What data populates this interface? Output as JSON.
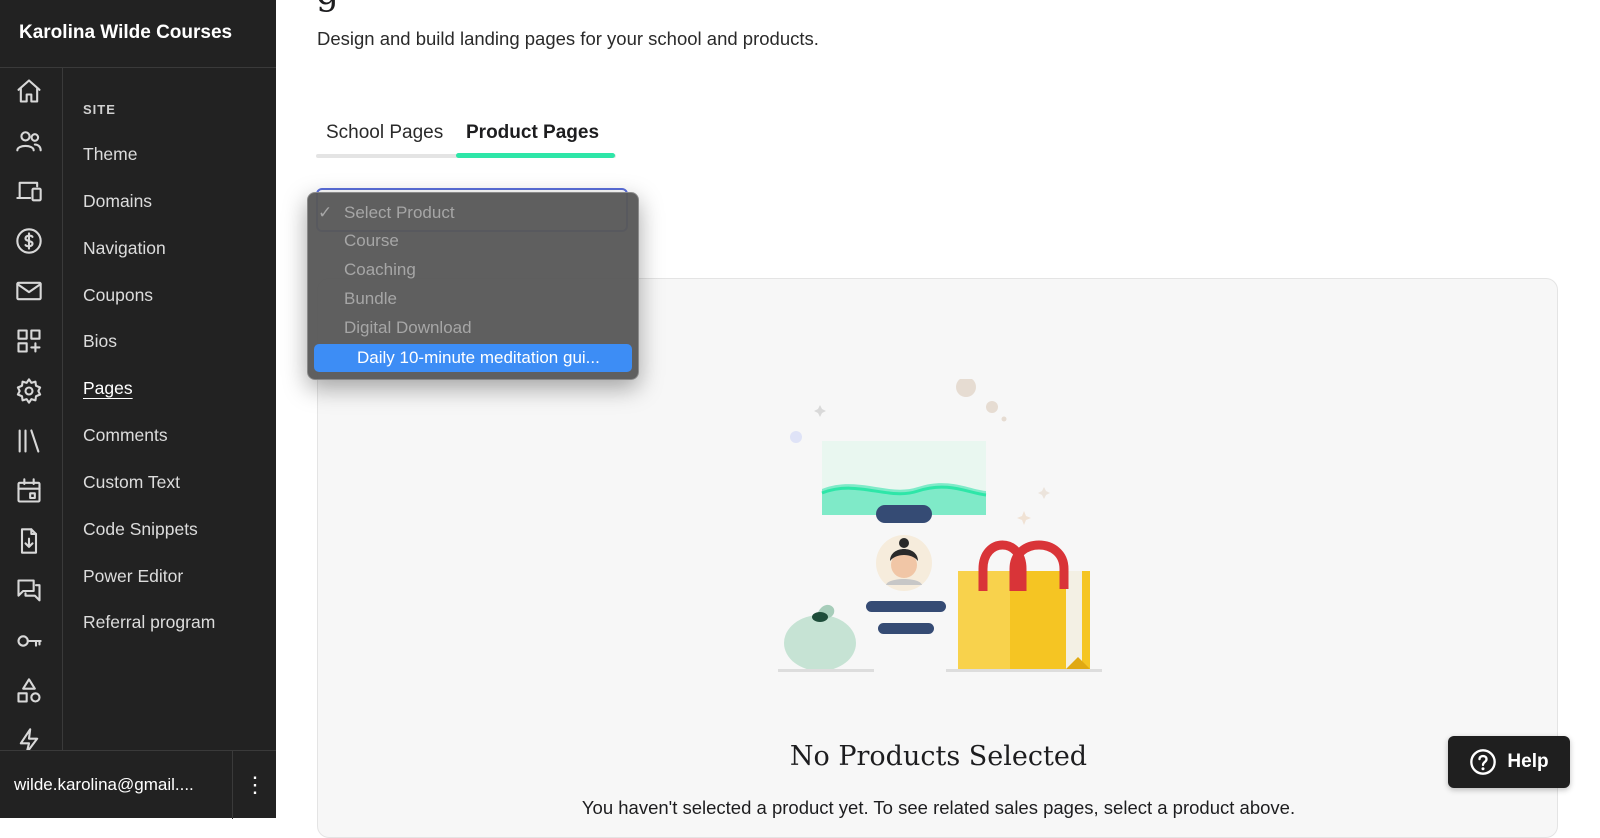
{
  "brand": {
    "name": "Karolina Wilde Courses"
  },
  "rail": {
    "icons": [
      "home-icon",
      "users-icon",
      "devices-icon",
      "dollar-icon",
      "mail-icon",
      "apps-icon",
      "gear-icon",
      "library-icon",
      "calendar-icon",
      "download-icon",
      "chat-icon",
      "key-icon",
      "shapes-icon",
      "lightning-icon"
    ]
  },
  "subnav": {
    "heading": "SITE",
    "items": [
      {
        "label": "Theme"
      },
      {
        "label": "Domains"
      },
      {
        "label": "Navigation"
      },
      {
        "label": "Coupons"
      },
      {
        "label": "Bios"
      },
      {
        "label": "Pages",
        "active": true
      },
      {
        "label": "Comments"
      },
      {
        "label": "Custom Text"
      },
      {
        "label": "Code Snippets"
      },
      {
        "label": "Power Editor"
      },
      {
        "label": "Referral program"
      }
    ]
  },
  "account": {
    "email": "wilde.karolina@gmail....",
    "menu_glyph": "⋮"
  },
  "page": {
    "title_remnant": "g",
    "subtitle": "Design and build landing pages for your school and products."
  },
  "tabs": [
    {
      "label": "School Pages",
      "active": false
    },
    {
      "label": "Product Pages",
      "active": true
    }
  ],
  "dropdown": {
    "check_glyph": "✓",
    "options": [
      {
        "label": "Select Product",
        "selected": true
      },
      {
        "label": "Course"
      },
      {
        "label": "Coaching"
      },
      {
        "label": "Bundle"
      },
      {
        "label": "Digital Download"
      },
      {
        "label": "Daily 10-minute meditation gui...",
        "highlighted": true
      }
    ]
  },
  "empty_state": {
    "title": "No Products Selected",
    "description": "You haven't selected a product yet. To see related sales pages, select a product above."
  },
  "help": {
    "label": "Help"
  },
  "colors": {
    "sidebar_bg": "#222222",
    "tab_accent": "#2ee6a8",
    "dropdown_highlight": "#3d8df5",
    "help_bg": "#1f1f1f"
  }
}
